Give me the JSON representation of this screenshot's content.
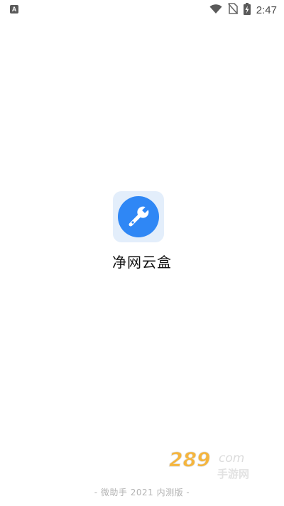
{
  "status_bar": {
    "notification_icon": "A",
    "time": "2:47",
    "icons": [
      "wifi-icon",
      "no-sim-icon",
      "battery-charging-icon"
    ]
  },
  "app": {
    "name": "净网云盒",
    "icon": "wrench-icon",
    "icon_color": "#2f87f5",
    "icon_bg_color": "#e3eefb"
  },
  "watermark": {
    "main": "289",
    "suffix": "com",
    "sub": "手游网"
  },
  "footer": {
    "text": "- 微助手  2021  内测版   -"
  }
}
